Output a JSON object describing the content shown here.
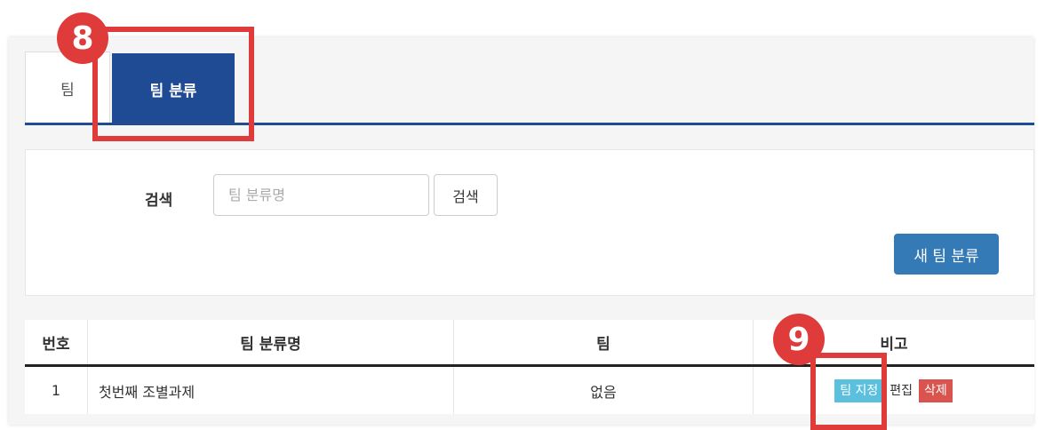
{
  "tabs": [
    {
      "label": "팀"
    },
    {
      "label": "팀 분류"
    }
  ],
  "search": {
    "label": "검색",
    "placeholder": "팀 분류명",
    "value": "",
    "button_label": "검색"
  },
  "new_button_label": "새 팀 분류",
  "table": {
    "headers": [
      "번호",
      "팀 분류명",
      "팀",
      "비고"
    ],
    "rows": [
      {
        "number": "1",
        "name": "첫번째 조별과제",
        "team": "없음",
        "actions": {
          "assign": "팀 지정",
          "edit": "편집",
          "delete": "삭제"
        }
      }
    ]
  },
  "annotations": {
    "marker_8": "8",
    "marker_9": "9",
    "highlight_color": "#e03b3b"
  },
  "colors": {
    "active_tab": "#1f4b94",
    "primary_button": "#337ab7",
    "assign_badge": "#5bc0de",
    "delete_badge": "#d9534f"
  }
}
